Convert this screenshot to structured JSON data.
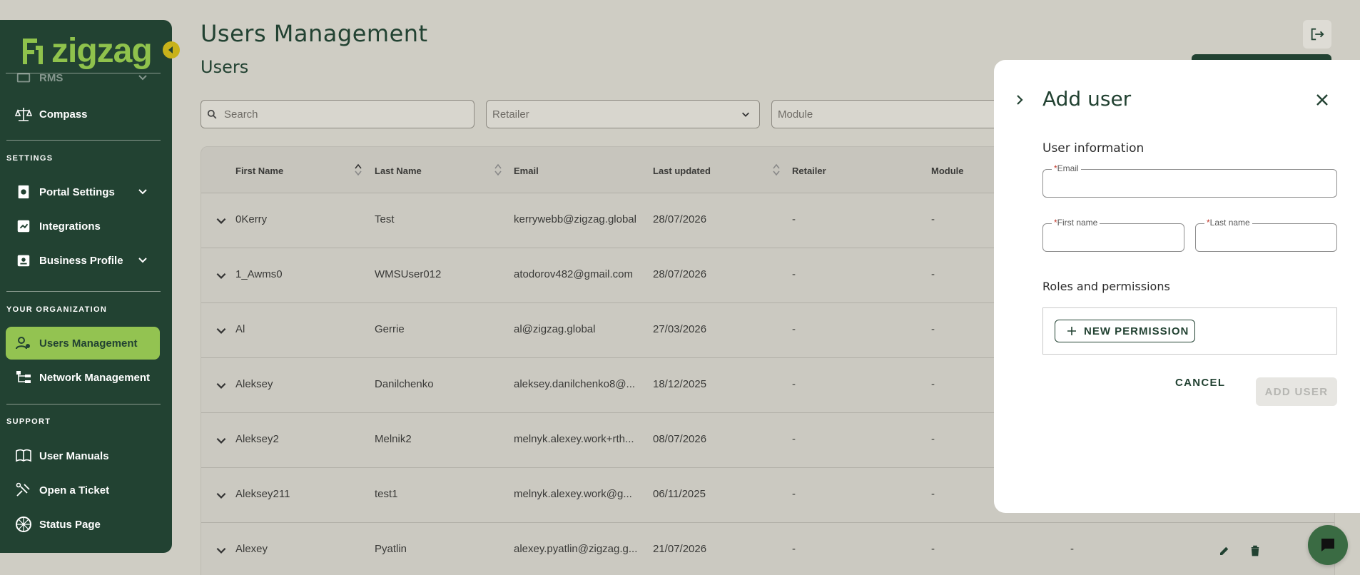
{
  "sidebar": {
    "logo_text": "zigzag",
    "items_top": [
      {
        "label": "RMS"
      },
      {
        "label": "Compass"
      }
    ],
    "sections": {
      "settings": "SETTINGS",
      "org": "YOUR ORGANIZATION",
      "support": "SUPPORT"
    },
    "settings_items": [
      {
        "label": "Portal Settings"
      },
      {
        "label": "Integrations"
      },
      {
        "label": "Business Profile"
      }
    ],
    "org_items": [
      {
        "label": "Users Management"
      },
      {
        "label": "Network Management"
      }
    ],
    "support_items": [
      {
        "label": "User Manuals"
      },
      {
        "label": "Open a Ticket"
      },
      {
        "label": "Status Page"
      }
    ]
  },
  "header": {
    "title": "Users Management",
    "subtitle": "Users"
  },
  "filters": {
    "search_placeholder": "Search",
    "retailer_placeholder": "Retailer",
    "module_placeholder": "Module"
  },
  "table": {
    "columns": [
      "First Name",
      "Last Name",
      "Email",
      "Last updated",
      "Retailer",
      "Module"
    ],
    "rows": [
      {
        "first": "0Kerry",
        "last": "Test",
        "email": "kerrywebb@zigzag.global",
        "updated": "28/07/2026",
        "retailer": "-",
        "module": "-"
      },
      {
        "first": "1_Awms0",
        "last": "WMSUser012",
        "email": "atodorov482@gmail.com",
        "updated": "28/07/2026",
        "retailer": "-",
        "module": "-"
      },
      {
        "first": "Al",
        "last": "Gerrie",
        "email": "al@zigzag.global",
        "updated": "27/03/2026",
        "retailer": "-",
        "module": "-"
      },
      {
        "first": "Aleksey",
        "last": "Danilchenko",
        "email": "aleksey.danilchenko8@...",
        "updated": "18/12/2025",
        "retailer": "-",
        "module": "-"
      },
      {
        "first": "Aleksey2",
        "last": "Melnik2",
        "email": "melnyk.alexey.work+rth...",
        "updated": "08/07/2026",
        "retailer": "-",
        "module": "-"
      },
      {
        "first": "Aleksey211",
        "last": "test1",
        "email": "melnyk.alexey.work@g...",
        "updated": "06/11/2025",
        "retailer": "-",
        "module": "-"
      },
      {
        "first": "Alexey",
        "last": "Pyatlin",
        "email": "alexey.pyatlin@zigzag.g...",
        "updated": "21/07/2026",
        "retailer": "-",
        "module": "-",
        "extra": "-"
      }
    ]
  },
  "drawer": {
    "title": "Add user",
    "user_info_label": "User information",
    "email_label": "Email",
    "email_value": "",
    "first_name_label": "First name",
    "first_name_value": "",
    "last_name_label": "Last name",
    "last_name_value": "",
    "required_mark": "*",
    "roles_label": "Roles and permissions",
    "new_permission_label": "NEW PERMISSION",
    "cancel_label": "CANCEL",
    "add_user_label": "ADD USER"
  },
  "colors": {
    "brand_dark": "#224232",
    "brand_light": "#93c351",
    "accent_yellow": "#c8b21a"
  }
}
